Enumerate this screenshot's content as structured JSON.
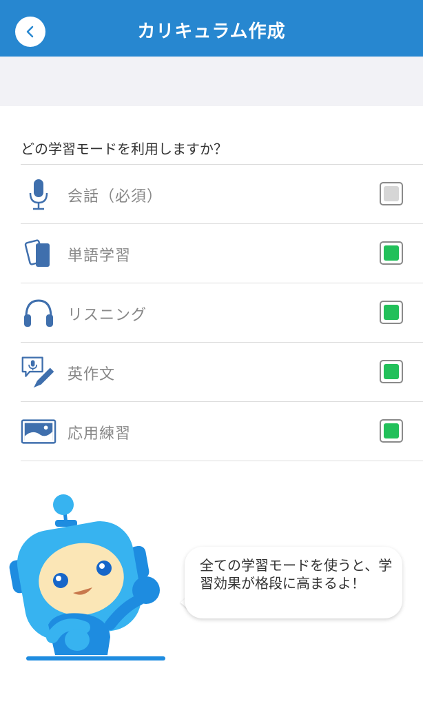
{
  "header": {
    "title": "カリキュラム作成"
  },
  "question": "どの学習モードを利用しますか？",
  "modes": [
    {
      "label": "会話（必須）",
      "icon": "microphone-icon",
      "checked": true,
      "disabled": true
    },
    {
      "label": "単語学習",
      "icon": "flashcards-icon",
      "checked": true,
      "disabled": false
    },
    {
      "label": "リスニング",
      "icon": "headphones-icon",
      "checked": true,
      "disabled": false
    },
    {
      "label": "英作文",
      "icon": "speech-pencil-icon",
      "checked": true,
      "disabled": false
    },
    {
      "label": "応用練習",
      "icon": "landscape-card-icon",
      "checked": true,
      "disabled": false
    }
  ],
  "mascot": {
    "message": "全ての学習モードを使うと、学習効果が格段に高まるよ！"
  },
  "colors": {
    "header": "#2787d0",
    "icon": "#3f6fad",
    "checked": "#22c05a",
    "disabled_fill": "#d6d6d6",
    "robot": "#37b3f0"
  }
}
